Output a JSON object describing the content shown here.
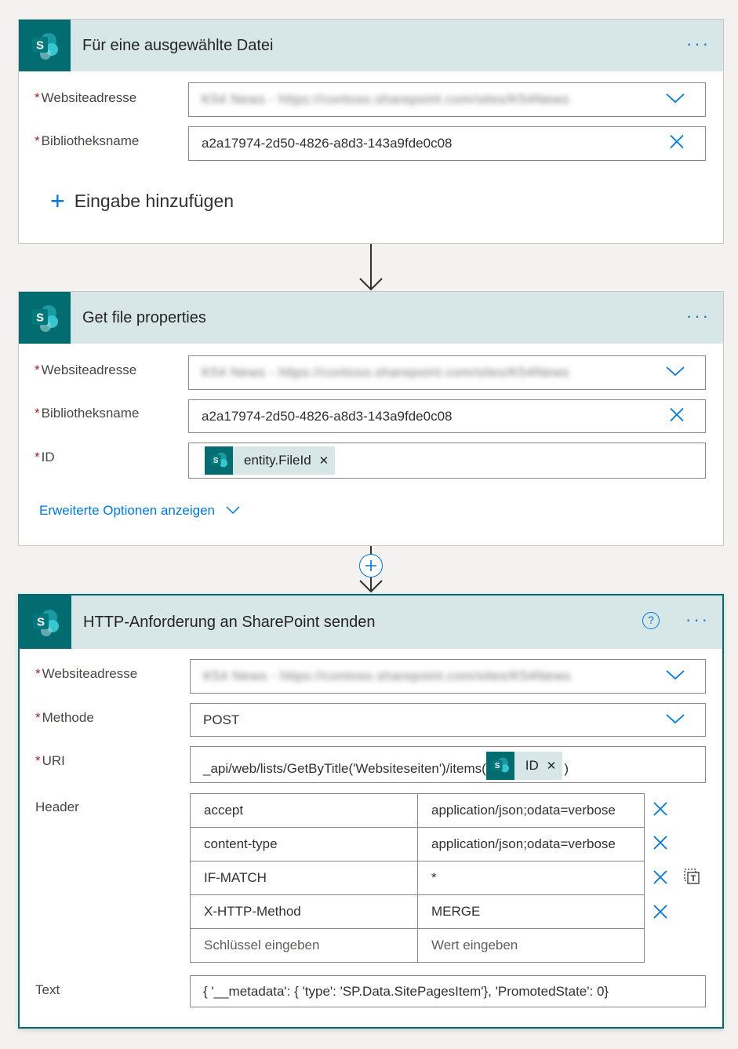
{
  "card1": {
    "title": "Für eine ausgewählte Datei",
    "site_label": "Websiteadresse",
    "site_value": "K54 News - https://contoso.sharepoint.com/sites/K54News",
    "library_label": "Bibliotheksname",
    "library_value": "a2a17974-2d50-4826-a8d3-143a9fde0c08",
    "add_input_label": "Eingabe hinzufügen"
  },
  "card2": {
    "title": "Get file properties",
    "site_label": "Websiteadresse",
    "site_value": "K54 News - https://contoso.sharepoint.com/sites/K54News",
    "library_label": "Bibliotheksname",
    "library_value": "a2a17974-2d50-4826-a8d3-143a9fde0c08",
    "id_label": "ID",
    "id_token": "entity.FileId",
    "advanced_link": "Erweiterte Optionen anzeigen"
  },
  "card3": {
    "title": "HTTP-Anforderung an SharePoint senden",
    "site_label": "Websiteadresse",
    "site_value": "K54 News - https://contoso.sharepoint.com/sites/K54News",
    "method_label": "Methode",
    "method_value": "POST",
    "uri_label": "URI",
    "uri_prefix": "_api/web/lists/GetByTitle('Websiteseiten')/items(",
    "uri_token": "ID",
    "uri_suffix": ")",
    "header_label": "Header",
    "headers": [
      {
        "key": "accept",
        "value": "application/json;odata=verbose"
      },
      {
        "key": "content-type",
        "value": "application/json;odata=verbose"
      },
      {
        "key": "IF-MATCH",
        "value": "*"
      },
      {
        "key": "X-HTTP-Method",
        "value": "MERGE"
      }
    ],
    "key_placeholder": "Schlüssel eingeben",
    "value_placeholder": "Wert eingeben",
    "body_label": "Text",
    "body_value": "{ '__metadata': { 'type': 'SP.Data.SitePagesItem'}, 'PromotedState': 0}"
  },
  "colors": {
    "sharepoint": "#036c70",
    "header_bg": "#d7e7e8",
    "accent": "#0078d4",
    "required": "#a4262c"
  }
}
